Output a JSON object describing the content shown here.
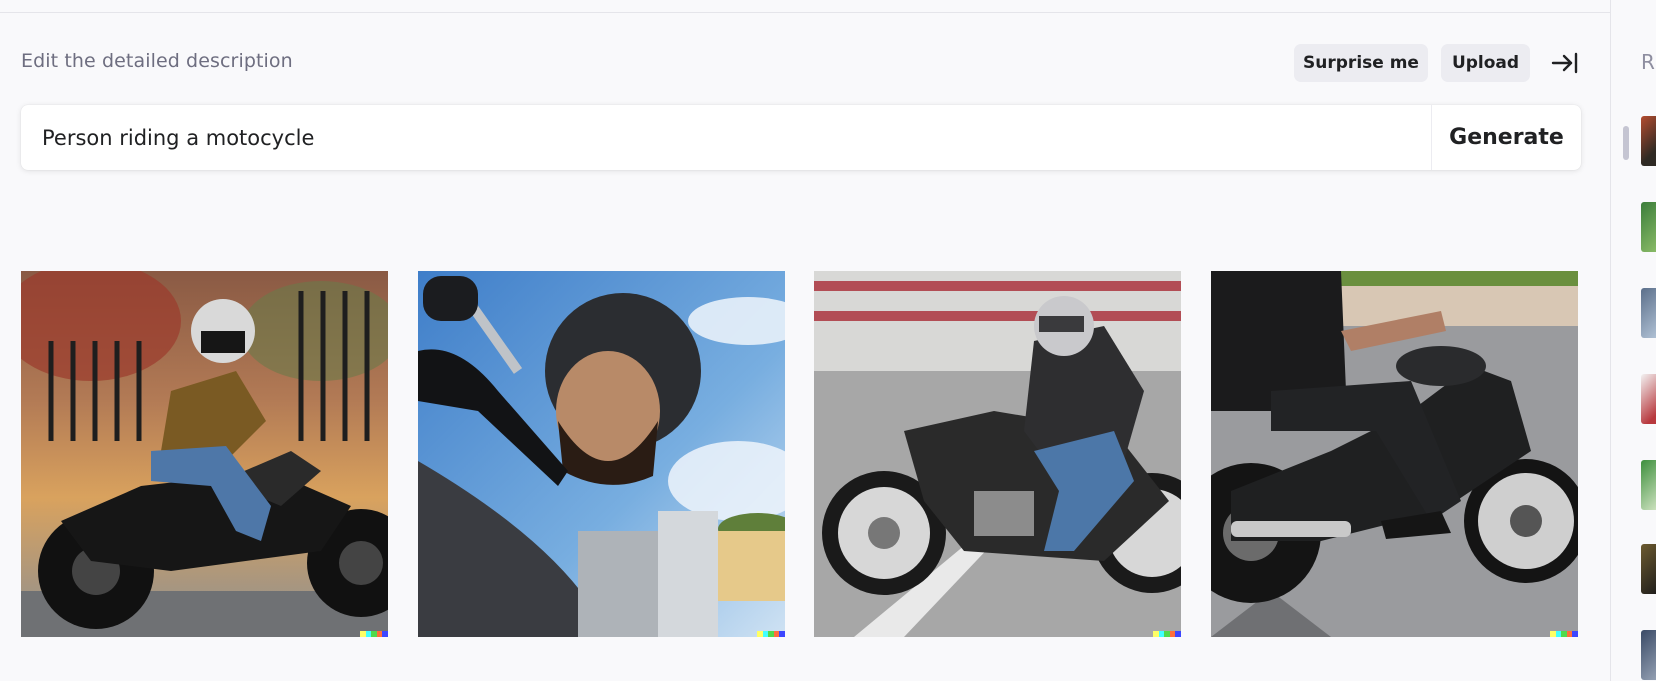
{
  "header": {
    "description_label": "Edit the detailed description",
    "surprise_label": "Surprise me",
    "upload_label": "Upload",
    "collapse_icon": "collapse-right-icon"
  },
  "prompt": {
    "value": "Person riding a motocycle",
    "generate_label": "Generate"
  },
  "results": [
    {
      "alt": "Rider in brown jacket and white helmet on a black motorcycle by a fence"
    },
    {
      "alt": "Bearded man in helmet, close-up from motorcycle"
    },
    {
      "alt": "Rider in black leather jacket on a silver motorcycle in motion"
    },
    {
      "alt": "Rider on a black cruiser motorcycle on a road"
    }
  ],
  "sidebar": {
    "heading": "R"
  },
  "colors": {
    "accent": "#202123",
    "muted": "#6e6e80",
    "pill_bg": "#ececf1",
    "signature": [
      "#ffff66",
      "#42ffff",
      "#51da4c",
      "#ff6e3c",
      "#3c46ff"
    ]
  }
}
